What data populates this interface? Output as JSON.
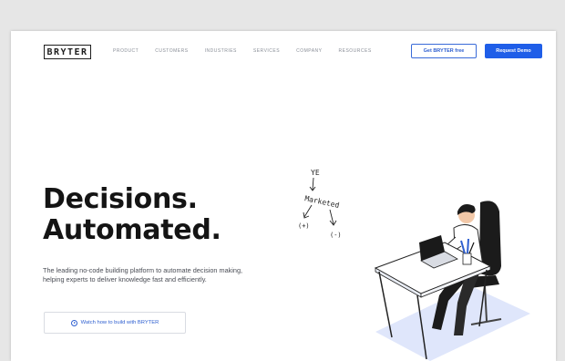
{
  "header": {
    "logo_text": "BRYTER",
    "nav": [
      "PRODUCT",
      "CUSTOMERS",
      "INDUSTRIES",
      "SERVICES",
      "COMPANY",
      "RESOURCES"
    ],
    "get_free_label": "Get BRYTER free",
    "request_demo_label": "Request Demo"
  },
  "hero": {
    "headline_line1": "Decisions.",
    "headline_line2": "Automated.",
    "subtext": "The leading no-code building platform to automate decision making, helping experts to deliver knowledge fast and efficiently.",
    "watch_label": "Watch how to build with BRYTER"
  },
  "sketch": {
    "top": "YE",
    "middle": "Marketed",
    "left": "(+)",
    "right": "(-)"
  },
  "colors": {
    "accent": "#1f5ee8",
    "text": "#141414",
    "background": "#e6e6e6"
  },
  "icons": [
    "play-circle-icon"
  ]
}
